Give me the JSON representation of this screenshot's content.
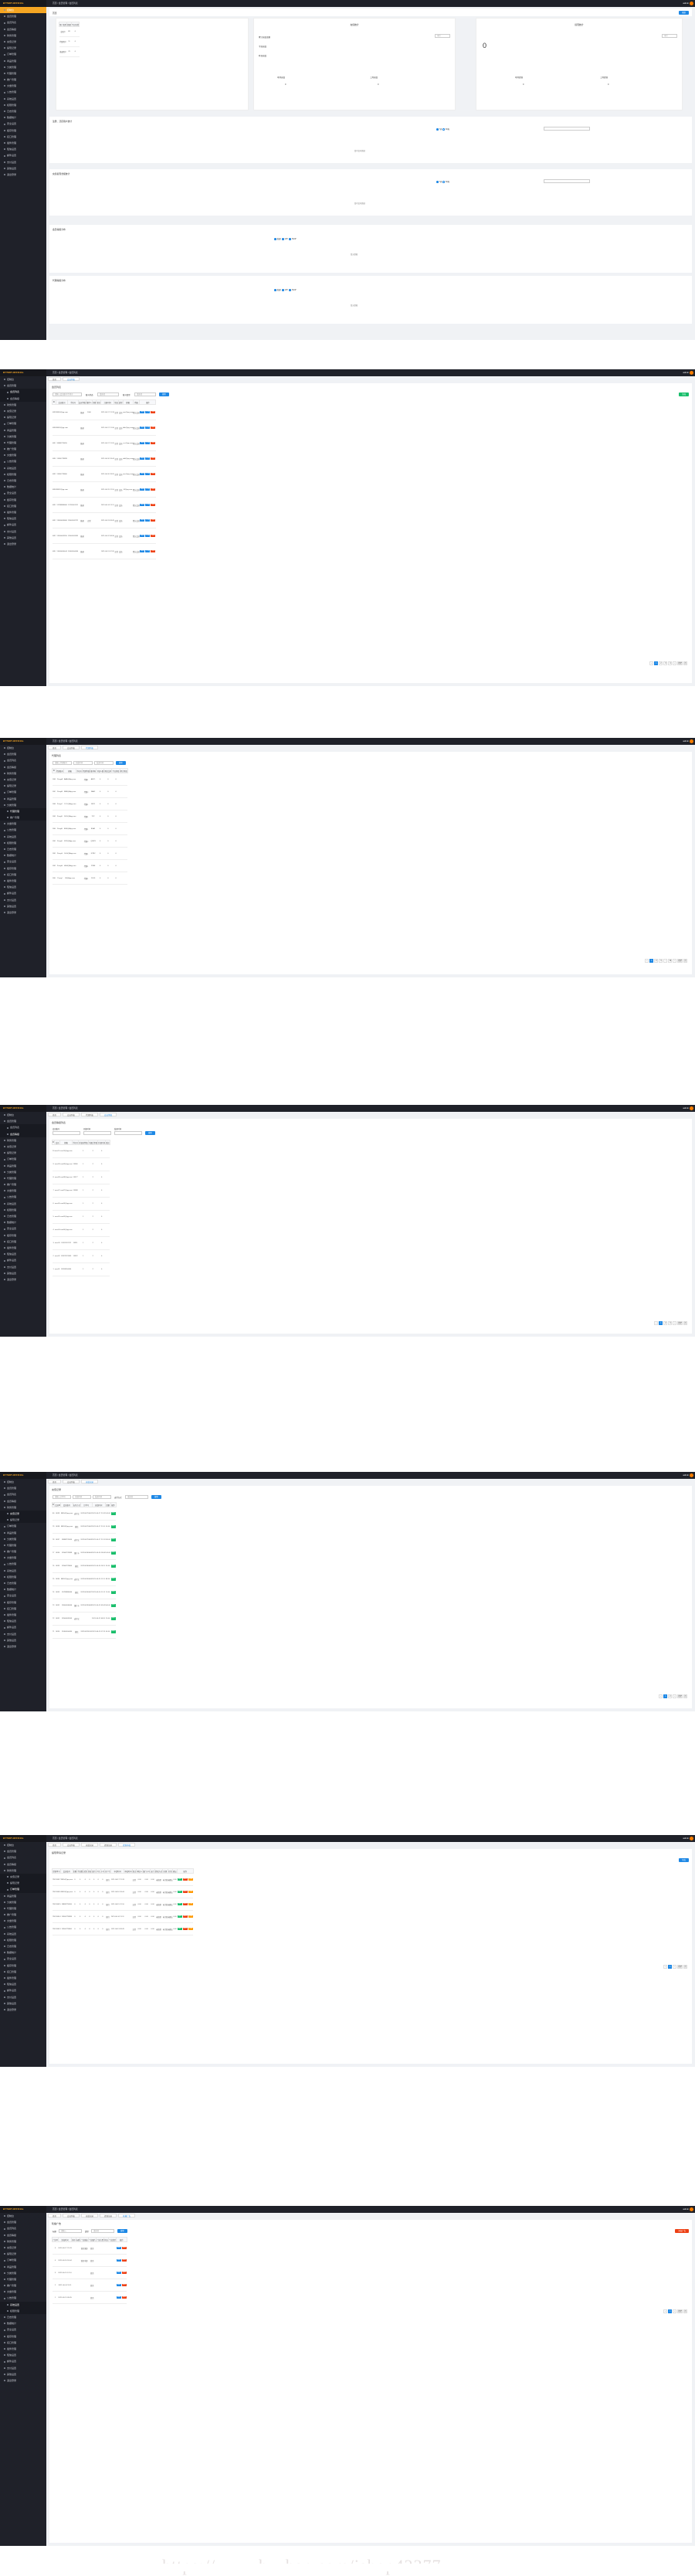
{
  "brand": "BYTEDT-OFFICIAL",
  "topbar": {
    "home": "首页",
    "user": "admin",
    "crumb": "首页 / 会员管理 / 会员列表"
  },
  "menu": [
    "控制台",
    "会员管理",
    "会员列表",
    "会员等级",
    "财务管理",
    "充值记录",
    "提现记录",
    "订单管理",
    "商品管理",
    "分类管理",
    "代理管理",
    "推广管理",
    "文章管理",
    "公告管理",
    "系统设置",
    "权限管理",
    "日志管理",
    "数据统计",
    "安全设置",
    "缓存管理",
    "接口管理",
    "插件管理",
    "短信设置",
    "邮件设置",
    "支付设置",
    "其他设置",
    "退出登录"
  ],
  "dashboard": {
    "title": "首页",
    "btn": "刷新",
    "card1": {
      "head": [
        "用户类型",
        "数量",
        "今日新增"
      ],
      "rows": [
        [
          "总用户",
          "89",
          "0"
        ],
        [
          "代理用户",
          "11",
          "0"
        ],
        [
          "普通用户",
          "78",
          "0"
        ]
      ]
    },
    "card2": {
      "title": "充值统计",
      "lines": [
        "累计充值金额",
        "今日充值",
        "昨日充值"
      ],
      "sub": [
        "本月充值",
        "上月充值"
      ],
      "val": [
        "0",
        "0"
      ],
      "tag": "本月"
    },
    "card3": {
      "title": "提现统计",
      "big": "0",
      "sub": [
        "本月提现",
        "上月提现"
      ],
      "val": [
        "0",
        "0"
      ],
      "tag": "本月"
    },
    "sec1": {
      "label": "注册、活跃用户统计",
      "radio": [
        "7天",
        "30天"
      ],
      "nodata": "暂时没有数据"
    },
    "sec2": {
      "label": "充值提现金额统计",
      "radio": [
        "7天",
        "30天"
      ],
      "nodata": "暂时没有数据"
    },
    "sec3": {
      "label": "会员等级分布",
      "legend": [
        "普通",
        "VIP",
        "SVIP"
      ],
      "nodata": "暂无数据"
    },
    "sec4": {
      "label": "代理等级分布",
      "legend": [
        "普通",
        "VIP",
        "SVIP"
      ],
      "nodata": "暂无数据"
    }
  },
  "s2": {
    "title": "会员列表",
    "tabs": [
      "首页",
      "会员列表"
    ],
    "search": [
      "请输入会员账号/手机号",
      "账号状态",
      "请选择",
      "账号类型",
      "请选择"
    ],
    "search_btn": "搜索",
    "add_btn": "添加",
    "head": [
      "ID",
      "会员账号",
      "手机号",
      "会员等级",
      "推荐人",
      "余额",
      "积分",
      "注册时间",
      "状态",
      "类型",
      "邮箱",
      "所属",
      "操作"
    ],
    "rows": [
      [
        "8039",
        "88654@qq.com",
        "",
        "普通",
        "1000",
        "",
        "",
        "2021-06-17 21:33",
        "正常",
        "会员",
        "aaa@qq.com",
        "默认会员"
      ],
      [
        "8038",
        "88653@qq.com",
        "",
        "普通",
        "",
        "",
        "",
        "2021-06-17 21:30",
        "正常",
        "会员",
        "bbb@qq.com",
        "默认会员"
      ],
      [
        "8037",
        "18888776655",
        "",
        "普通",
        "",
        "",
        "",
        "2021-06-17 21:20",
        "正常",
        "会员",
        "ccc@qq.com",
        "默认会员"
      ],
      [
        "8036",
        "13566778899",
        "",
        "普通",
        "",
        "",
        "",
        "2021-06-16 18:44",
        "正常",
        "会员",
        "ddd@qq.com",
        "默认会员"
      ],
      [
        "8035",
        "13566778800",
        "",
        "普通",
        "",
        "",
        "",
        "2021-06-16 18:20",
        "正常",
        "会员",
        "eee@qq.com",
        "默认会员"
      ],
      [
        "8034",
        "88652@qq.com",
        "",
        "普通",
        "",
        "",
        "",
        "2021-06-15 12:10",
        "正常",
        "会员",
        "fff@qq.com",
        "默认会员"
      ],
      [
        "8033",
        "13788886666",
        "13700001111",
        "普通",
        "",
        "",
        "",
        "2021-06-14 11:11",
        "正常",
        "会员",
        "",
        "默认会员"
      ],
      [
        "8032",
        "13600006666",
        "13600002222",
        "普通",
        "正常",
        "",
        "",
        "2021-06-13 09:45",
        "正常",
        "会员",
        "",
        "默认会员"
      ],
      [
        "8031",
        "13500005555",
        "13500003333",
        "普通",
        "",
        "",
        "",
        "2021-06-12 08:30",
        "正常",
        "会员",
        "",
        "默认会员"
      ],
      [
        "8030",
        "13400004444",
        "13400004444",
        "普通",
        "",
        "",
        "",
        "2021-06-11 07:20",
        "正常",
        "会员",
        "",
        "默认会员"
      ]
    ],
    "ops": [
      "编辑",
      "详情",
      "删除"
    ],
    "pages": [
      "‹",
      "1",
      "2",
      "3",
      "4",
      "›",
      "跳至",
      "页"
    ]
  },
  "s3": {
    "title": "代理列表",
    "tabs": [
      "首页",
      "会员列表",
      "代理列表"
    ],
    "search": [
      "请输入代理账号",
      "开始时间",
      "结束时间"
    ],
    "search_btn": "搜索",
    "head": [
      "ID",
      "代理账号",
      "邮箱",
      "手机号",
      "代理等级",
      "推荐码",
      "下级人数",
      "佣金比例",
      "今日佣金",
      "累计佣金"
    ],
    "rows": [
      [
        "2048",
        "ProxyA",
        "AAA@Aqq.com",
        "",
        "代理1",
        "ABC1",
        "0",
        "0",
        "0"
      ],
      [
        "2047",
        "ProxyB",
        "BBB@Aqq.com",
        "",
        "代理2",
        "FAB2",
        "0",
        "0",
        "0"
      ],
      [
        "2046",
        "ProxyC",
        "CCC@Aqq.com",
        "",
        "代理1",
        "8821",
        "0",
        "0",
        "0"
      ],
      [
        "2045",
        "ProxyD",
        "DDD@Aqq.com",
        "",
        "代理1",
        "7XY",
        "0",
        "0",
        "0"
      ],
      [
        "2044",
        "ProxyE",
        "EEE@Aqq.com",
        "",
        "代理1",
        "B5A1",
        "0",
        "0",
        "0"
      ],
      [
        "2043",
        "ProxyF",
        "FFF@Aqq.com",
        "",
        "代理2",
        "Q8W3",
        "0",
        "0",
        "0"
      ],
      [
        "2042",
        "ProxyG",
        "GGG@Aqq.com",
        "",
        "代理1",
        "K7M2",
        "0",
        "0",
        "0"
      ],
      [
        "2041",
        "ProxyH",
        "HHH@Aqq.com",
        "",
        "代理1",
        "Z3N8",
        "0",
        "0",
        "0"
      ],
      [
        "2040",
        "ProxyI",
        "III@Aqq.com",
        "",
        "代理1",
        "P4L9",
        "0",
        "0",
        "0"
      ]
    ],
    "pages": [
      "‹",
      "1",
      "2",
      "3",
      "…",
      "10",
      "›",
      "跳至",
      "页"
    ]
  },
  "s4": {
    "title": "会员等级列表",
    "tabs": [
      "首页",
      "会员列表",
      "代理列表",
      "会员等级"
    ],
    "search": [
      "会员账号",
      "开始时间",
      "结束时间"
    ],
    "search_btn": "搜索",
    "head": [
      "ID",
      "会员",
      "邮箱",
      "手机号",
      "升级前等级",
      "升级后等级",
      "升级时间",
      "备注"
    ],
    "rows": [
      [
        "10",
        "user10",
        "user10@qq.com",
        "",
        "1",
        "2",
        "0"
      ],
      [
        "9",
        "user09",
        "user09@qq.com",
        "13566",
        "1",
        "2",
        "0"
      ],
      [
        "8",
        "user08",
        "user08@qq.com",
        "13577",
        "1",
        "2",
        "0"
      ],
      [
        "7",
        "user07",
        "user07@qq.com",
        "13588",
        "1",
        "2",
        "0"
      ],
      [
        "6",
        "user06",
        "user06@qq.com",
        "",
        "1",
        "2",
        "0"
      ],
      [
        "5",
        "user05",
        "user05@qq.com",
        "",
        "1",
        "2",
        "0"
      ],
      [
        "4",
        "user04",
        "user04@qq.com",
        "",
        "1",
        "2",
        "0"
      ],
      [
        "3",
        "user03",
        "13911112222",
        "13911",
        "1",
        "2",
        "0"
      ],
      [
        "2",
        "user02",
        "13922223333",
        "13922",
        "1",
        "2",
        "0"
      ],
      [
        "1",
        "user01",
        "13933334444",
        "",
        "1",
        "2",
        "0"
      ]
    ],
    "pages": [
      "‹",
      "1",
      "2",
      "3",
      "›",
      "跳至",
      "页"
    ]
  },
  "s5": {
    "title": "充值记录",
    "tabs": [
      "首页",
      "会员列表",
      "充值记录"
    ],
    "search": [
      "请输入订单号",
      "开始时间",
      "结束时间",
      "支付方式",
      "请选择"
    ],
    "search_btn": "搜索",
    "head": [
      "ID",
      "会员ID",
      "会员账号",
      "支付方式",
      "订单号",
      "充值时间",
      "金额",
      "操作"
    ],
    "rows": [
      [
        "80",
        "8039",
        "88654@qq.com",
        "支付宝",
        "202106170001",
        "2021-06-17 21:33",
        "100.00"
      ],
      [
        "79",
        "8038",
        "88653@qq.com",
        "微信",
        "202106170002",
        "2021-06-17 21:30",
        "50.00"
      ],
      [
        "78",
        "8037",
        "18888776655",
        "支付宝",
        "202106170003",
        "2021-06-17 21:20",
        "200.00"
      ],
      [
        "77",
        "8036",
        "13566778899",
        "银行卡",
        "202106160004",
        "2021-06-16 18:44",
        "100.00"
      ],
      [
        "76",
        "8035",
        "13566778800",
        "微信",
        "202106160005",
        "2021-06-16 18:20",
        "30.00"
      ],
      [
        "75",
        "8034",
        "88652@qq.com",
        "支付宝",
        "202106150006",
        "2021-06-15 12:10",
        "88.00"
      ],
      [
        "74",
        "8033",
        "13788886666",
        "微信",
        "202106140007",
        "2021-06-14 11:11",
        "10.00"
      ],
      [
        "73",
        "8032",
        "13600006666",
        "银行卡",
        "202106130008",
        "2021-06-13 09:45",
        "500.00"
      ],
      [
        "72",
        "8031",
        "13500005555",
        "支付宝",
        "",
        "2021-06-12 08:30",
        "20.00"
      ],
      [
        "71",
        "8030",
        "13400004444",
        "微信",
        "202106110010",
        "2021-06-11 07:20",
        "60.00"
      ]
    ],
    "op": "审核",
    "pages": [
      "‹",
      "1",
      "2",
      "›",
      "跳至",
      "页"
    ]
  },
  "s6": {
    "title": "提现申请记录",
    "tabs": [
      "首页",
      "会员列表",
      "充值记录",
      "提现记录",
      "提现审核"
    ],
    "btn": "导出",
    "head": [
      "提现单号",
      "会员账号",
      "金额",
      "手续费",
      "实到",
      "状态",
      "银行",
      "户名",
      "卡号",
      "开户行",
      "申请时间",
      "审核时间",
      "备注",
      "审核人",
      "银行卡号",
      "支行",
      "提现方式",
      "处理",
      "打款",
      "确认",
      "操作"
    ],
    "rows": [
      [
        "T20210617",
        "88654@qq.com",
        "0",
        "0",
        "0",
        "0",
        "0",
        "0",
        "0",
        "银行",
        "2021-06-17 21:33",
        "",
        "正常",
        "0.00",
        "0.00",
        "0.00",
        "未处理",
        "未打款",
        "未确认",
        "0.00"
      ],
      [
        "T20210616",
        "88653@qq.com",
        "0",
        "0",
        "0",
        "0",
        "0",
        "0",
        "0",
        "银行",
        "2021-06-16 18:44",
        "",
        "正常",
        "0.00",
        "0.00",
        "0.00",
        "未处理",
        "未打款",
        "未确认",
        "0.00"
      ],
      [
        "T20210615",
        "18888776655",
        "0",
        "0",
        "0",
        "0",
        "0",
        "0",
        "0",
        "银行",
        "2021-06-15 12:10",
        "",
        "正常",
        "0.00",
        "0.00",
        "0.00",
        "未处理",
        "未打款",
        "未确认",
        "0.00"
      ],
      [
        "T20210614",
        "13566778899",
        "0",
        "0",
        "0",
        "0",
        "0",
        "0",
        "0",
        "银行",
        "2021-06-14 11:11",
        "",
        "正常",
        "0.00",
        "0.00",
        "0.00",
        "未处理",
        "未打款",
        "未确认",
        "0.00"
      ],
      [
        "T20210613",
        "13566778800",
        "0",
        "0",
        "0",
        "0",
        "0",
        "0",
        "0",
        "银行",
        "2021-06-13 09:45",
        "",
        "正常",
        "0.00",
        "0.00",
        "0.00",
        "未处理",
        "未打款",
        "未确认",
        "0.00"
      ]
    ],
    "ops": [
      "通过",
      "拒绝",
      "详情"
    ],
    "pages": [
      "‹",
      "1",
      "›",
      "跳至",
      "页"
    ]
  },
  "s7": {
    "title": "轮播广告",
    "tabs": [
      "首页",
      "会员列表",
      "充值记录",
      "提现记录",
      "轮播广告"
    ],
    "search": [
      "标题",
      "请输入",
      "类型",
      "请选择"
    ],
    "search_btn": "搜索",
    "add_btn": "添加广告",
    "head": [
      "广告ID",
      "添加时间",
      "排序",
      "标题",
      "广告链接",
      "广告图片",
      "广告位置",
      "状态",
      "广告类型",
      "操作"
    ],
    "rows": [
      [
        "5",
        "2021-06-17 21:33",
        "",
        "",
        "首页顶部",
        "首页",
        ""
      ],
      [
        "4",
        "2021-06-16 18:44",
        "",
        "",
        "首页中部",
        "首页",
        ""
      ],
      [
        "3",
        "2021-06-15 12:10",
        "",
        "",
        "",
        "首页",
        ""
      ],
      [
        "2",
        "2021-06-14 11:11",
        "",
        "",
        "",
        "首页",
        ""
      ],
      [
        "1",
        "2021-06-13 09:45",
        "",
        "",
        "",
        "首页",
        ""
      ]
    ],
    "ops": [
      "编辑",
      "删除"
    ],
    "pages": [
      "‹",
      "1",
      "›",
      "跳至",
      "页"
    ]
  },
  "watermark": "https://www.huzhan.com/ishop42377"
}
